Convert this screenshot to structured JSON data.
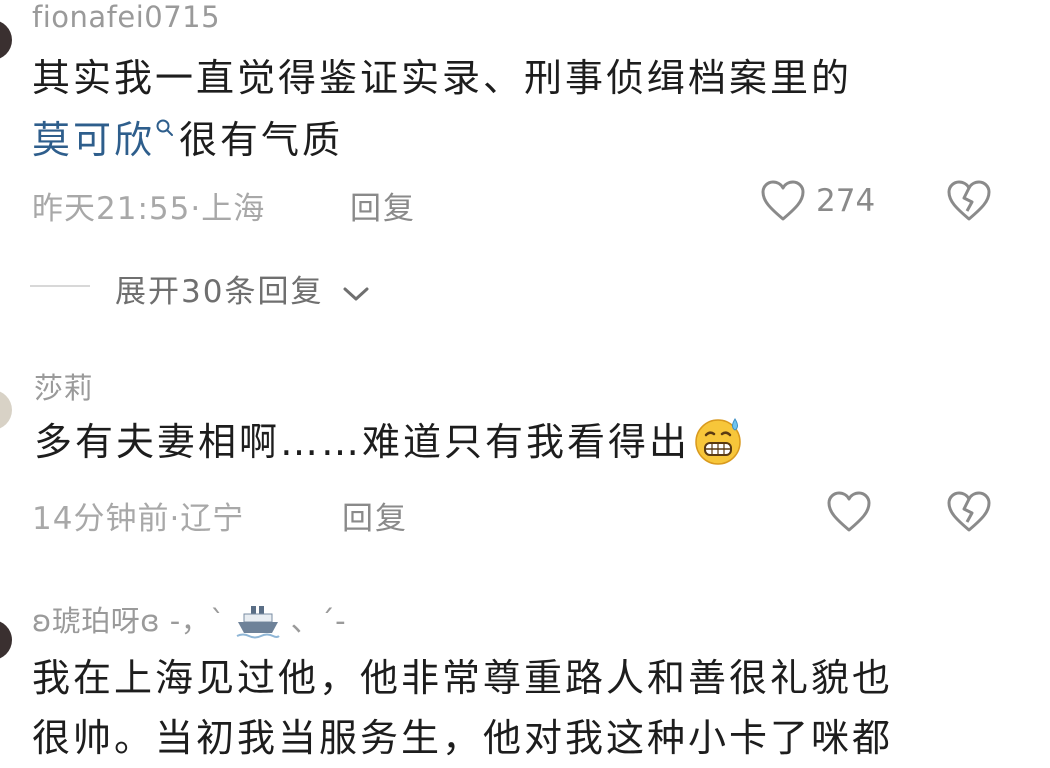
{
  "comments": [
    {
      "username": "fionafei0715",
      "content_line1": "其实我一直觉得鉴证实录、刑事侦缉档案里的",
      "content_link": "莫可欣",
      "content_line2_rest": "很有气质",
      "time_location": "昨天21:55·上海",
      "reply_label": "回复",
      "like_count": "274",
      "expand_label": "展开30条回复"
    },
    {
      "username": "莎莉",
      "content": "多有夫妻相啊……难道只有我看得出",
      "emoji": "grinning-sweat-emoji",
      "time_location": "14分钟前·辽宁",
      "reply_label": "回复"
    },
    {
      "username_prefix": "ʚ琥珀呀ɞ",
      "username_suffix_a": "-，ˋ",
      "username_suffix_b": "、ˊ-",
      "content_line1": "我在上海见过他，他非常尊重路人和善很礼貌也",
      "content_line2": "很帅。当初我当服务生，他对我这种小卡了咪都"
    }
  ],
  "icons": {
    "like": "heart-outline-icon",
    "dislike": "broken-heart-icon",
    "search": "search-icon",
    "expand": "chevron-down-icon",
    "ship": "ship-icon"
  },
  "colors": {
    "link": "#2e5e8c",
    "meta": "#a8a8a8",
    "text": "#1d1d1d"
  }
}
